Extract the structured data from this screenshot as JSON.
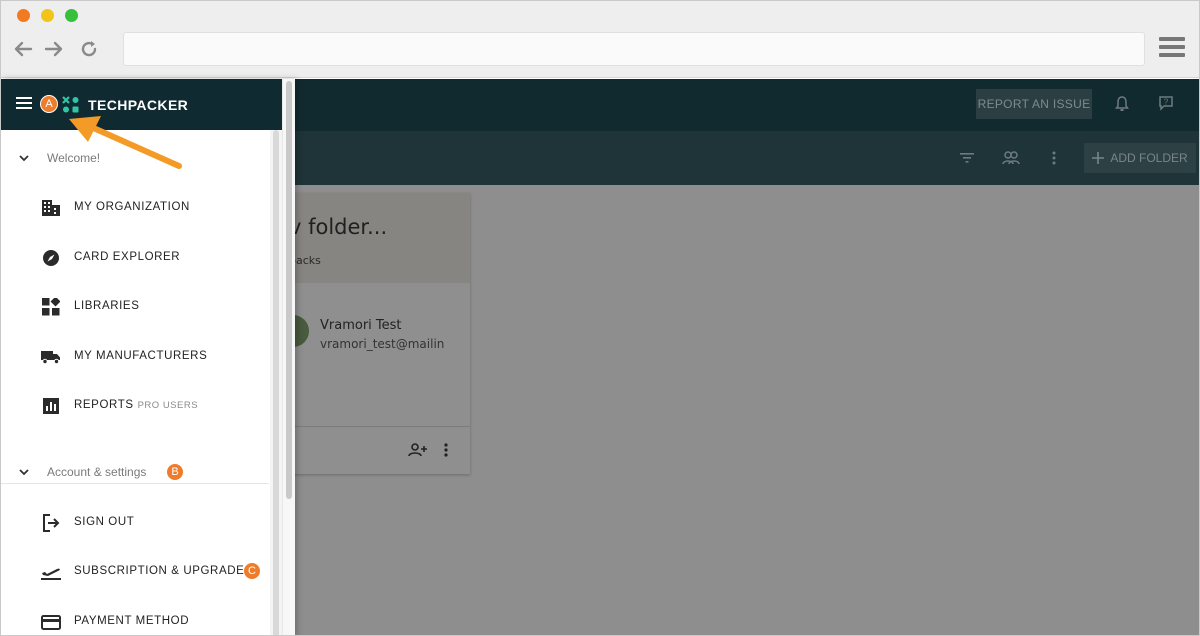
{
  "browser": {
    "url": ""
  },
  "topbar": {
    "report_label": "REPORT AN ISSUE"
  },
  "toolbar": {
    "add_folder_label": "ADD FOLDER"
  },
  "card": {
    "title": "v folder...",
    "subtitle": "packs",
    "member_name": "Vramori Test",
    "member_email": "vramori_test@mailin"
  },
  "drawer": {
    "brand": "TECHPACKER",
    "badges": {
      "a": "A",
      "b": "B",
      "c": "C"
    },
    "sections": [
      {
        "label": "Welcome!",
        "items": [
          {
            "label": "MY ORGANIZATION",
            "icon": "building-icon"
          },
          {
            "label": "CARD EXPLORER",
            "icon": "compass-icon"
          },
          {
            "label": "LIBRARIES",
            "icon": "widgets-icon"
          },
          {
            "label": "MY MANUFACTURERS",
            "icon": "truck-icon"
          },
          {
            "label": "REPORTS",
            "extra": "PRO USERS",
            "icon": "bar-chart-icon"
          }
        ]
      },
      {
        "label": "Account & settings",
        "items": [
          {
            "label": "SIGN OUT",
            "icon": "sign-out-icon"
          },
          {
            "label": "SUBSCRIPTION & UPGRADE",
            "icon": "flight-takeoff-icon"
          },
          {
            "label": "PAYMENT METHOD",
            "icon": "credit-card-icon"
          }
        ]
      }
    ]
  },
  "colors": {
    "header_dark": "#0f2a30",
    "badge_orange": "#ef7c2b",
    "logo_teal": "#2fc6a6",
    "overlay_gray": "#8e8e8e"
  }
}
